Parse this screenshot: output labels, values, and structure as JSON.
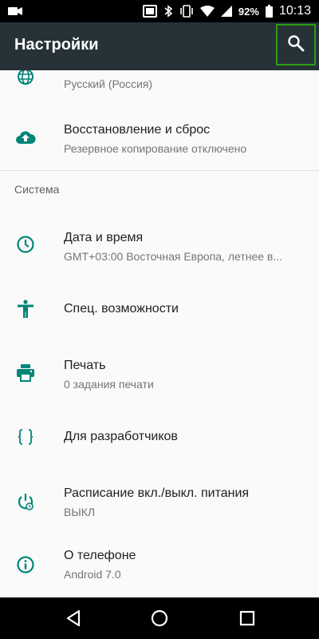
{
  "status_bar": {
    "battery": "92%",
    "time": "10:13"
  },
  "app_bar": {
    "title": "Настройки"
  },
  "settings": {
    "language_subtitle": "Русский (Россия)",
    "backup": {
      "title": "Восстановление и сброс",
      "subtitle": "Резервное копирование отключено"
    },
    "section_system": "Система",
    "datetime": {
      "title": "Дата и время",
      "subtitle": "GMT+03:00 Восточная Европа, летнее в..."
    },
    "accessibility": {
      "title": "Спец. возможности"
    },
    "printing": {
      "title": "Печать",
      "subtitle": "0 задания печати"
    },
    "developer": {
      "title": "Для разработчиков"
    },
    "schedule": {
      "title": "Расписание вкл./выкл. питания",
      "subtitle": "ВЫКЛ"
    },
    "about": {
      "title": "О телефоне",
      "subtitle": "Android 7.0"
    }
  },
  "colors": {
    "app_bar": "#263238",
    "accent_icon": "#008577",
    "highlight": "#2e9c12"
  }
}
